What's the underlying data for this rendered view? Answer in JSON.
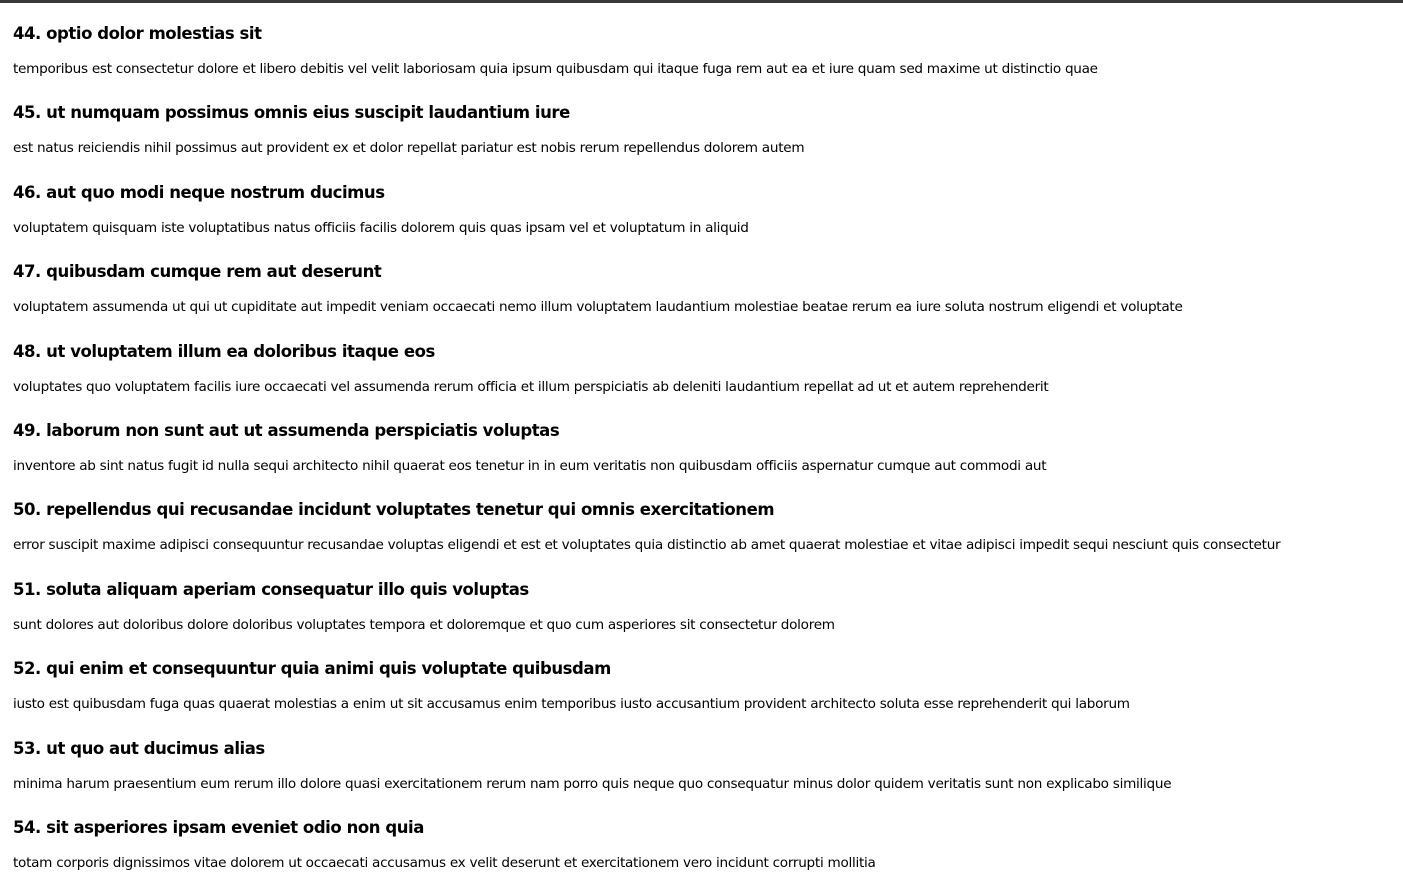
{
  "posts": [
    {
      "title": "44. optio dolor molestias sit",
      "body": "temporibus est consectetur dolore et libero debitis vel velit laboriosam quia ipsum quibusdam qui itaque fuga rem aut ea et iure quam sed maxime ut distinctio quae"
    },
    {
      "title": "45. ut numquam possimus omnis eius suscipit laudantium iure",
      "body": "est natus reiciendis nihil possimus aut provident ex et dolor repellat pariatur est nobis rerum repellendus dolorem autem"
    },
    {
      "title": "46. aut quo modi neque nostrum ducimus",
      "body": "voluptatem quisquam iste voluptatibus natus officiis facilis dolorem quis quas ipsam vel et voluptatum in aliquid"
    },
    {
      "title": "47. quibusdam cumque rem aut deserunt",
      "body": "voluptatem assumenda ut qui ut cupiditate aut impedit veniam occaecati nemo illum voluptatem laudantium molestiae beatae rerum ea iure soluta nostrum eligendi et voluptate"
    },
    {
      "title": "48. ut voluptatem illum ea doloribus itaque eos",
      "body": "voluptates quo voluptatem facilis iure occaecati vel assumenda rerum officia et illum perspiciatis ab deleniti laudantium repellat ad ut et autem reprehenderit"
    },
    {
      "title": "49. laborum non sunt aut ut assumenda perspiciatis voluptas",
      "body": "inventore ab sint natus fugit id nulla sequi architecto nihil quaerat eos tenetur in in eum veritatis non quibusdam officiis aspernatur cumque aut commodi aut"
    },
    {
      "title": "50. repellendus qui recusandae incidunt voluptates tenetur qui omnis exercitationem",
      "body": "error suscipit maxime adipisci consequuntur recusandae voluptas eligendi et est et voluptates quia distinctio ab amet quaerat molestiae et vitae adipisci impedit sequi nesciunt quis consectetur"
    },
    {
      "title": "51. soluta aliquam aperiam consequatur illo quis voluptas",
      "body": "sunt dolores aut doloribus dolore doloribus voluptates tempora et doloremque et quo cum asperiores sit consectetur dolorem"
    },
    {
      "title": "52. qui enim et consequuntur quia animi quis voluptate quibusdam",
      "body": "iusto est quibusdam fuga quas quaerat molestias a enim ut sit accusamus enim temporibus iusto accusantium provident architecto soluta esse reprehenderit qui laborum"
    },
    {
      "title": "53. ut quo aut ducimus alias",
      "body": "minima harum praesentium eum rerum illo dolore quasi exercitationem rerum nam porro quis neque quo consequatur minus dolor quidem veritatis sunt non explicabo similique"
    },
    {
      "title": "54. sit asperiores ipsam eveniet odio non quia",
      "body": "totam corporis dignissimos vitae dolorem ut occaecati accusamus ex velit deserunt et exercitationem vero incidunt corrupti mollitia"
    }
  ]
}
